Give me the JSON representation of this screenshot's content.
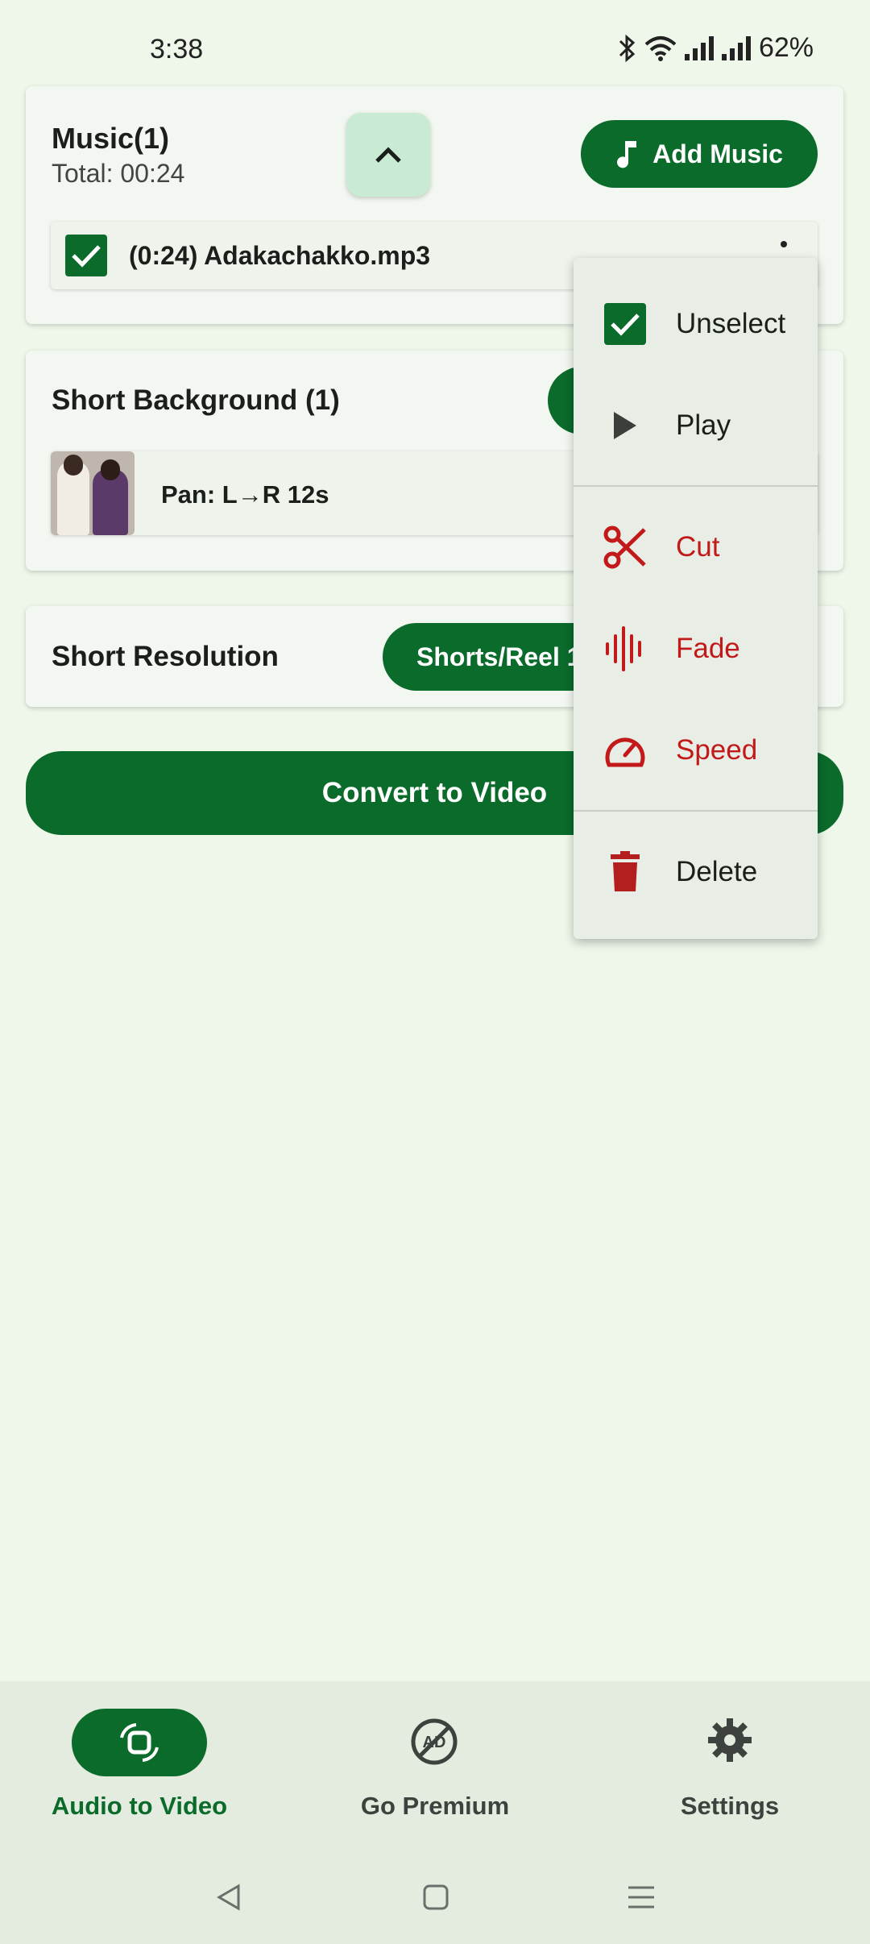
{
  "status": {
    "time": "3:38",
    "battery": "62%"
  },
  "music": {
    "title": "Music(1)",
    "total": "Total: 00:24",
    "add_label": "Add Music",
    "track": "(0:24) Adakachakko.mp3"
  },
  "background": {
    "title": "Short Background (1)",
    "item_label": "Pan: L→R 12s"
  },
  "resolution": {
    "title": "Short Resolution",
    "value": "Shorts/Reel 1"
  },
  "convert_label": "Convert to Video",
  "menu": {
    "unselect": "Unselect",
    "play": "Play",
    "cut": "Cut",
    "fade": "Fade",
    "speed": "Speed",
    "delete": "Delete"
  },
  "nav": {
    "audio_to_video": "Audio to Video",
    "go_premium": "Go Premium",
    "settings": "Settings"
  },
  "colors": {
    "primary": "#0a6b2b",
    "danger": "#c21a1a",
    "background": "#eef7ea"
  }
}
